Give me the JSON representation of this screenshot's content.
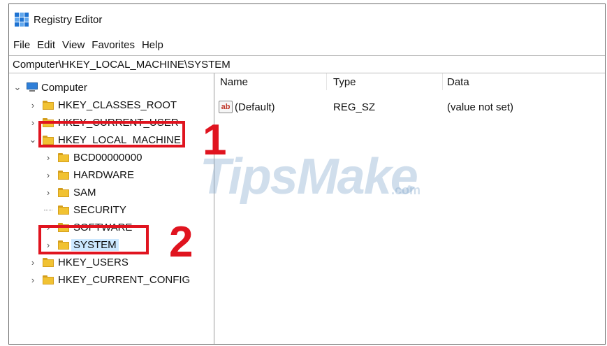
{
  "window": {
    "title": "Registry Editor",
    "menu": [
      "File",
      "Edit",
      "View",
      "Favorites",
      "Help"
    ],
    "address": "Computer\\HKEY_LOCAL_MACHINE\\SYSTEM"
  },
  "tree": {
    "root": "Computer",
    "items": [
      {
        "label": "HKEY_CLASSES_ROOT",
        "chevron": ">"
      },
      {
        "label": "HKEY_CURRENT_USER",
        "chevron": ">"
      },
      {
        "label": "HKEY_LOCAL_MACHINE",
        "chevron": "v"
      },
      {
        "label": "BCD00000000",
        "chevron": ">"
      },
      {
        "label": "HARDWARE",
        "chevron": ">"
      },
      {
        "label": "SAM",
        "chevron": ">"
      },
      {
        "label": "SECURITY",
        "chevron": ""
      },
      {
        "label": "SOFTWARE",
        "chevron": ">"
      },
      {
        "label": "SYSTEM",
        "chevron": ">",
        "selected": true
      },
      {
        "label": "HKEY_USERS",
        "chevron": ">"
      },
      {
        "label": "HKEY_CURRENT_CONFIG",
        "chevron": ">"
      }
    ]
  },
  "list": {
    "columns": [
      "Name",
      "Type",
      "Data"
    ],
    "rows": [
      {
        "name": "(Default)",
        "type": "REG_SZ",
        "data": "(value not set)",
        "icon": "ab"
      }
    ]
  },
  "annotations": {
    "callout1": "1",
    "callout2": "2",
    "color": "#e0141f"
  },
  "watermark": {
    "main": "TipsMake",
    "suffix": ".com"
  }
}
